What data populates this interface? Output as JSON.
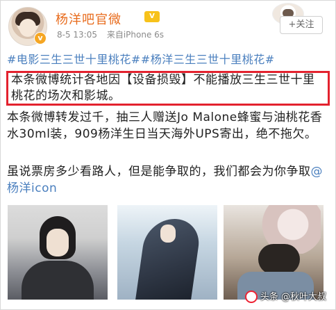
{
  "post": {
    "username": "杨洋吧官微",
    "vip_badge": "V",
    "verified_badge": "v",
    "time": "8-5 13:05",
    "source": "来自iPhone 6s",
    "follow_label": "+关注",
    "hashtags": [
      "#电影三生三世十里桃花#",
      "#杨洋三生三世十里桃花#"
    ],
    "highlight_text": "本条微博统计各地因【设备损毁】不能播放三生三世十里桃花的场次和影城。",
    "para2": "本条微博转发过千，抽三人赠送Jo Malone蜂蜜与油桃花香水30ml装，909杨洋生日当天海外UPS寄出，绝不拖欠。",
    "para3_text": "虽说票房多少看路人，但是能争取的，我们都会为你争取",
    "mention": "@杨洋icon",
    "images": [
      "photo-1",
      "photo-2",
      "photo-3"
    ]
  },
  "watermark": "头条 @秋叶大叔",
  "colors": {
    "username": "#e86b1c",
    "link": "#4a7fbe",
    "highlight_border": "#e3222e"
  }
}
